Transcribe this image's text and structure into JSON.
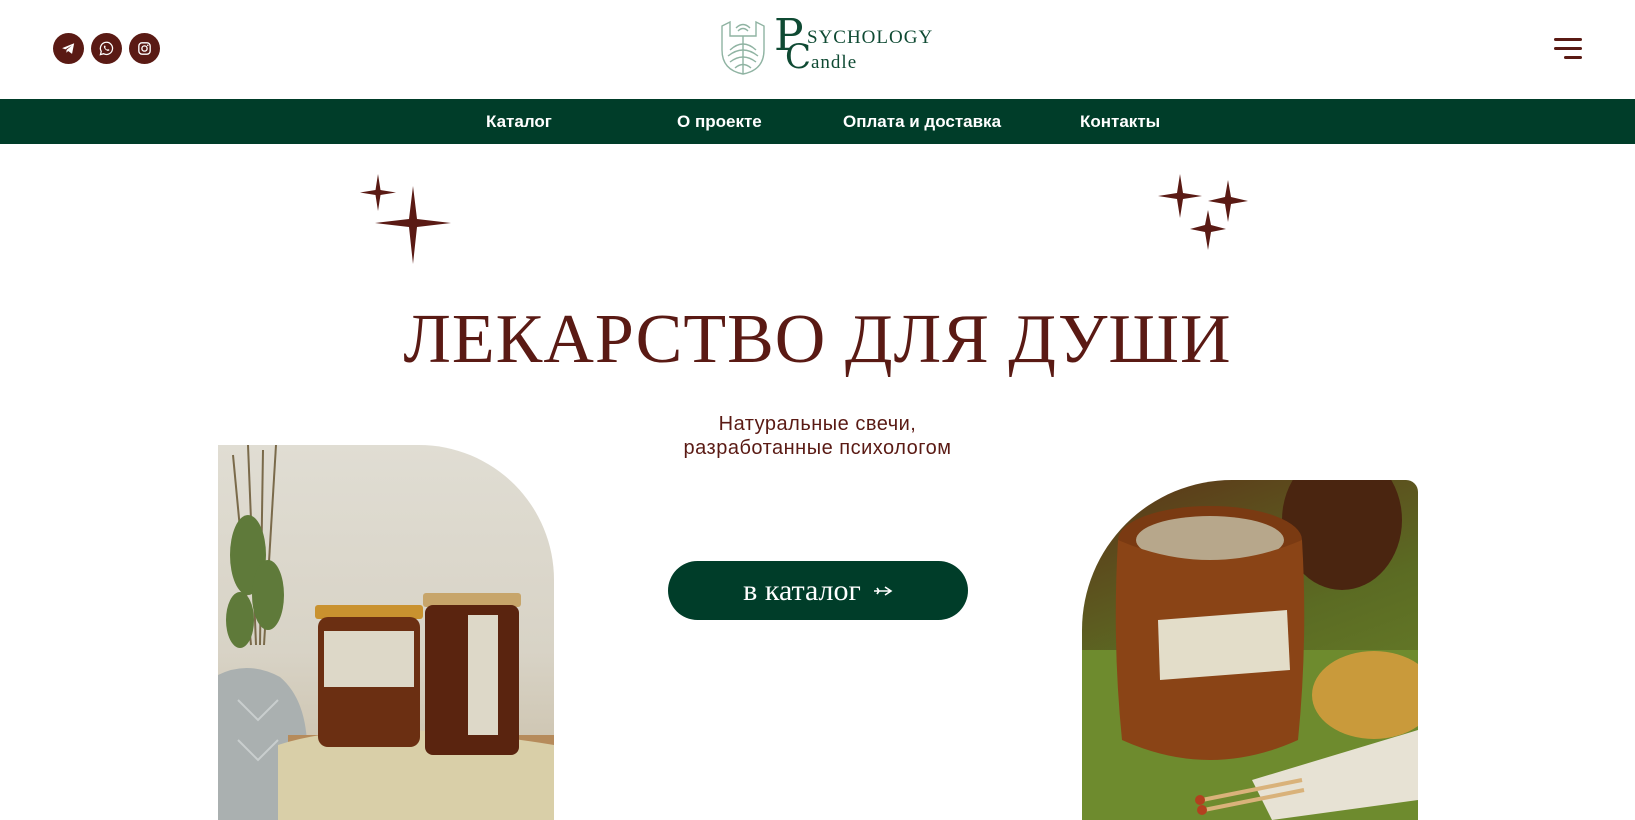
{
  "header": {
    "social": [
      {
        "icon": "telegram-icon"
      },
      {
        "icon": "whatsapp-icon"
      },
      {
        "icon": "instagram-icon"
      }
    ],
    "logo": {
      "letter_p": "P",
      "word_1": "SYCHOLOGY",
      "letter_c": "C",
      "word_2": "andle"
    },
    "menu_icon": "menu-icon"
  },
  "nav": {
    "items": [
      {
        "label": "Каталог"
      },
      {
        "label": "О проекте"
      },
      {
        "label": "Оплата и доставка"
      },
      {
        "label": "Контакты"
      }
    ]
  },
  "hero": {
    "title": "ЛЕКАРСТВО ДЛЯ ДУШИ",
    "subtitle_line1": "Натуральные свечи,",
    "subtitle_line2": "разработанные психологом",
    "cta_label": "в каталог",
    "cta_icon": "arrow-right-icon"
  },
  "colors": {
    "brand_green": "#003d29",
    "accent_brown": "#5a1a14",
    "logo_green": "#0f4a33",
    "background": "#ffffff"
  }
}
